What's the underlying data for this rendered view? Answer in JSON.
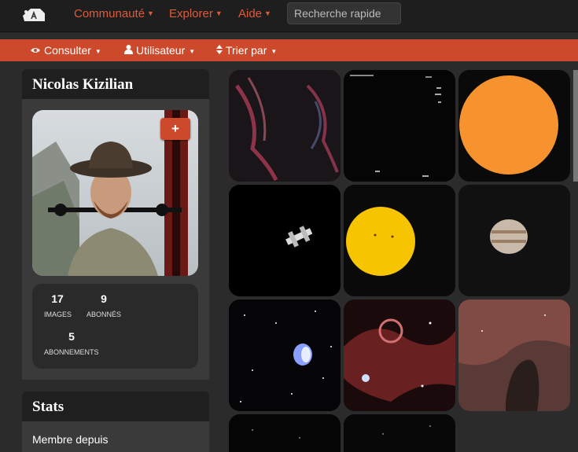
{
  "topnav": {
    "items": [
      {
        "label": "Communauté"
      },
      {
        "label": "Explorer"
      },
      {
        "label": "Aide"
      }
    ],
    "search_placeholder": "Recherche rapide"
  },
  "subnav": {
    "items": [
      {
        "label": "Consulter",
        "icon": "eye-icon"
      },
      {
        "label": "Utilisateur",
        "icon": "user-icon"
      },
      {
        "label": "Trier par",
        "icon": "sort-icon"
      }
    ]
  },
  "profile": {
    "name": "Nicolas Kizilian",
    "add_label": "+",
    "stats": [
      {
        "value": "17",
        "label": "IMAGES"
      },
      {
        "value": "9",
        "label": "ABONNÉS"
      },
      {
        "value": "5",
        "label": "ABONNEMENTS"
      }
    ]
  },
  "stats_panel": {
    "title": "Stats",
    "member_since_label": "Membre depuis"
  },
  "colors": {
    "accent": "#cc4a2b",
    "nav_text": "#e05a3a"
  }
}
